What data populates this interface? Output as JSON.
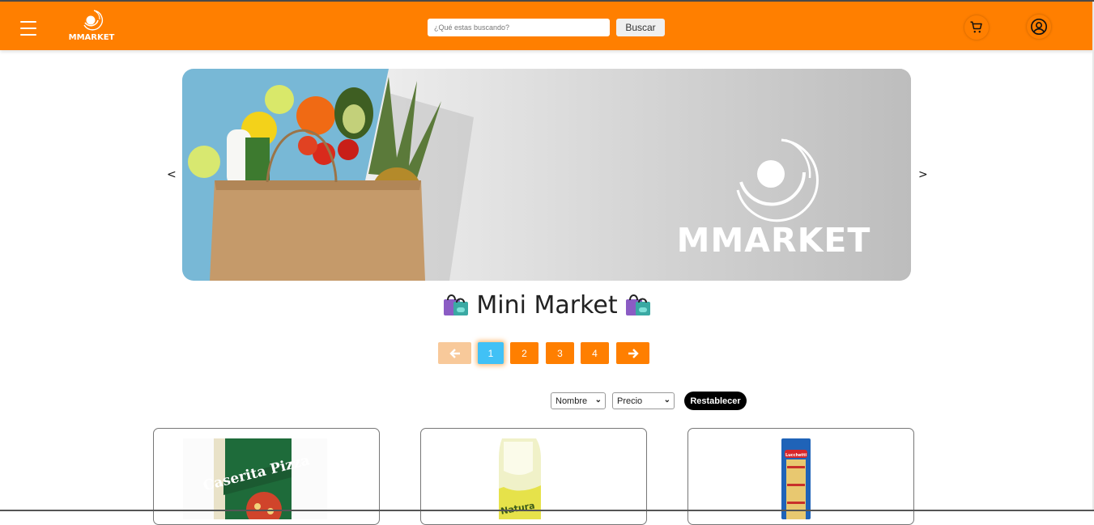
{
  "header": {
    "logo_text": "MMARKET",
    "search_placeholder": "¿Qué estas buscando?",
    "search_button": "Buscar",
    "menu_icon": "hamburger-menu-icon",
    "cart_icon": "cart-icon",
    "user_icon": "user-account-icon",
    "accent_color": "#ff7f00"
  },
  "carousel": {
    "prev_label": "<",
    "next_label": ">",
    "banner_text": "MMARKET"
  },
  "main": {
    "title": "Mini Market",
    "title_icon": "shopping-bags-emoji-icon"
  },
  "pagination": {
    "prev_icon": "arrow-left-icon",
    "next_icon": "arrow-right-icon",
    "pages": [
      "1",
      "2",
      "3",
      "4"
    ],
    "current_page": "1",
    "active_color": "#41c1f6"
  },
  "filters": {
    "name_select": "Nombre",
    "price_select": "Precio",
    "reset_button": "Restablecer"
  },
  "products": [
    {
      "image_label": "Caserita Pizza"
    },
    {
      "image_label": "Natura"
    },
    {
      "image_label": "Lucchetti"
    }
  ]
}
